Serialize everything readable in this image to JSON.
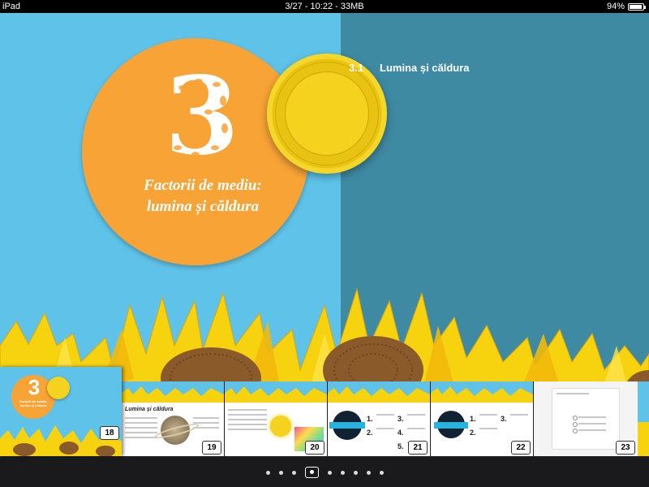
{
  "status_bar": {
    "device": "iPad",
    "center": "3/27 - 10:22 - 33MB",
    "battery": "94%",
    "battery_level": 0.94
  },
  "spread": {
    "chapter_number": "3",
    "chapter_title_line1": "Factorii de mediu:",
    "chapter_title_line2": "lumina și căldura",
    "section_number": "3.1",
    "section_title": "Lumina și căldura"
  },
  "thumbnails": {
    "current": {
      "page": "18",
      "title_line1": "Factorii de mediu:",
      "title_line2": "lumina și căldura"
    },
    "pages": [
      {
        "page": "19",
        "heading": "Lumina și căldura"
      },
      {
        "page": "20"
      },
      {
        "page": "21"
      },
      {
        "page": "22"
      },
      {
        "page": "23"
      }
    ]
  },
  "page_indicator": {
    "count": 9,
    "active_index": 3
  },
  "colors": {
    "sky": "#5fc3e9",
    "right_page": "#3e8aa3",
    "orange": "#f8a335",
    "sun": "#f4d21e"
  }
}
